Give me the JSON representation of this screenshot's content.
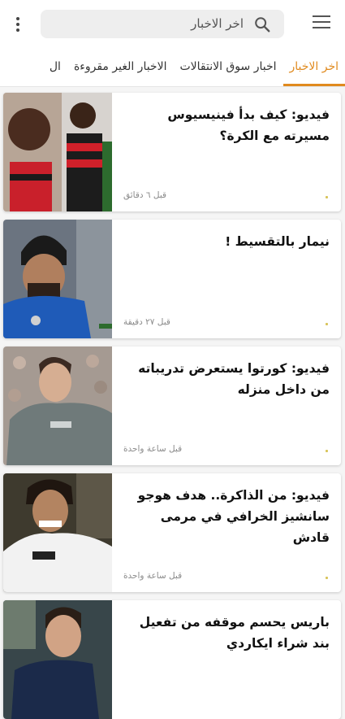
{
  "colors": {
    "accent": "#e08a1e",
    "card_bg": "#ffffff",
    "page_bg": "#f5f5f5"
  },
  "header": {
    "menu_icon": "hamburger-menu-icon",
    "overflow_icon": "kebab-vertical-icon",
    "search": {
      "text": "اخر الاخبار",
      "icon": "search-icon"
    }
  },
  "tabs": [
    {
      "label": "اخر الاخبار",
      "active": true
    },
    {
      "label": "اخبار سوق الانتقالات",
      "active": false
    },
    {
      "label": "الاخبار الغير مقروءة",
      "active": false
    },
    {
      "label": "ال",
      "active": false
    }
  ],
  "news": [
    {
      "title": "فيديو: كيف بدأ فينيسيوس مسيرته مع الكرة؟",
      "time": "قبل ٦ دقائق"
    },
    {
      "title": "نيمار بالتقسيط !",
      "time": "قبل ٢٧ دقيقة"
    },
    {
      "title": "فيديو: كورتوا يستعرض تدريباته من داخل منزله",
      "time": "قبل ساعة واحدة"
    },
    {
      "title": "فيديو: من الذاكرة.. هدف هوجو سانشيز الخرافي في مرمى قادش",
      "time": "قبل ساعة واحدة"
    },
    {
      "title": "باريس يحسم موقفه من تفعيل بند شراء ايكاردي",
      "time": ""
    }
  ]
}
